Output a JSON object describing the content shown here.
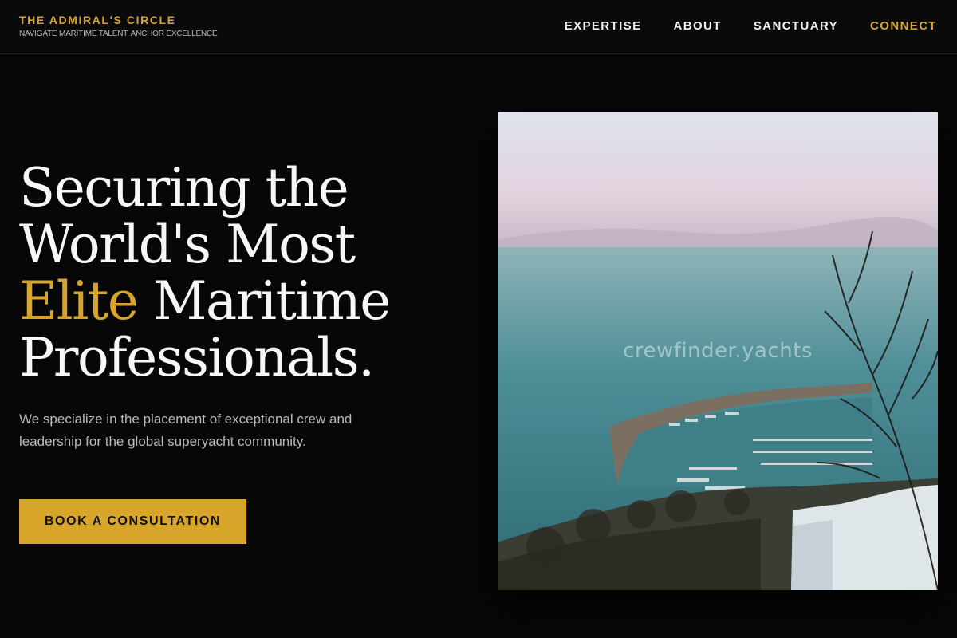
{
  "header": {
    "brand_title": "THE ADMIRAL'S CIRCLE",
    "brand_tagline": "NAVIGATE MARITIME TALENT, ANCHOR EXCELLENCE",
    "nav": [
      {
        "label": "EXPERTISE"
      },
      {
        "label": "ABOUT"
      },
      {
        "label": "SANCTUARY"
      },
      {
        "label": "CONNECT",
        "active": true
      }
    ]
  },
  "hero": {
    "headline_line1": "Securing the",
    "headline_line2": "World's Most",
    "headline_accent": "Elite",
    "headline_line3_rest": " Maritime",
    "headline_line4": "Professionals.",
    "description": "We specialize in the placement of exceptional crew and leadership for the global superyacht community.",
    "cta_label": "BOOK A CONSULTATION",
    "image_watermark": "crewfinder.yachts"
  },
  "colors": {
    "accent": "#d6a52a",
    "background": "#070707",
    "text": "#f7f7f7",
    "muted_text": "#b9b9b9"
  }
}
